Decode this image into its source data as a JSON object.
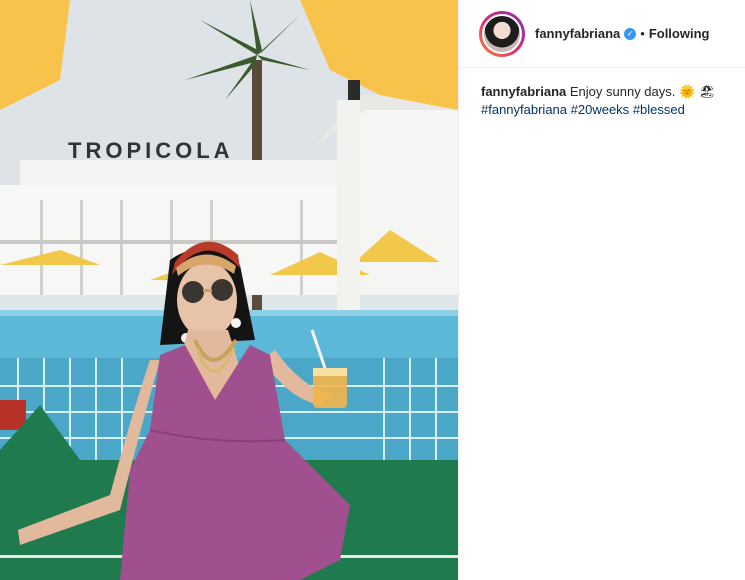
{
  "post": {
    "sign_text": "TROPICOLA"
  },
  "header": {
    "username": "fannyfabriana",
    "separator": "•",
    "follow_label": "Following"
  },
  "caption": {
    "username": "fannyfabriana",
    "text": "Enjoy sunny days.",
    "emoji": "🌞 🏖",
    "hashtags": [
      "#fannyfabriana",
      "#20weeks",
      "#blessed"
    ]
  },
  "colors": {
    "verified": "#3897f0",
    "hashtag": "#003569",
    "umbrella": "#f7c34a",
    "pool": "#5cb8d9",
    "dress": "#a0508f",
    "cushion": "#1f7a4e"
  },
  "icons": [
    "verified-badge-icon"
  ]
}
